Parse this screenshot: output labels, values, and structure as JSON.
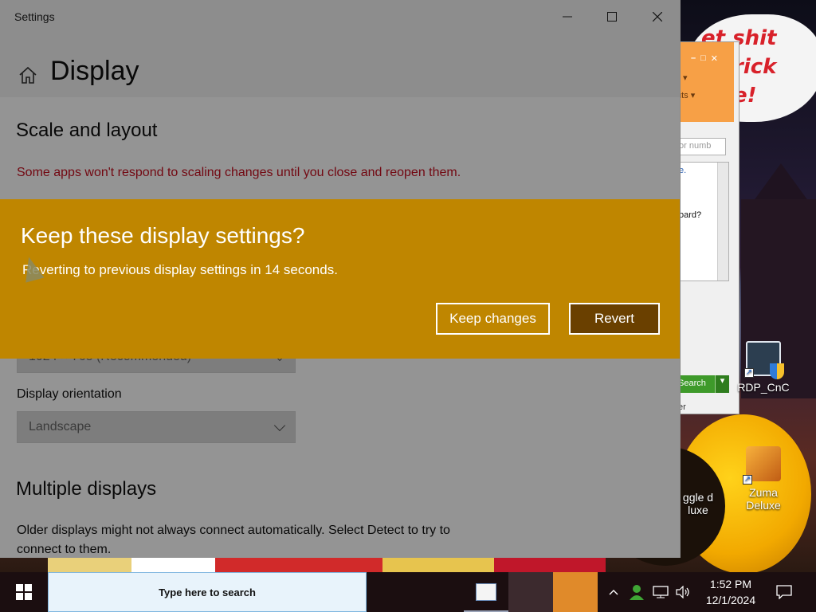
{
  "settings_window": {
    "app_title": "Settings",
    "page_title": "Display",
    "scale_section_title": "Scale and layout",
    "scaling_warning": "Some apps won't respond to scaling changes until you close and reopen them.",
    "resolution_value": "1024 × 768 (Recommended)",
    "orientation_label": "Display orientation",
    "orientation_value": "Landscape",
    "multiple_displays_title": "Multiple displays",
    "multiple_displays_text": "Older displays might not always connect automatically. Select Detect to try to connect to them."
  },
  "dialog": {
    "title": "Keep these display settings?",
    "message": "Reverting to previous display settings in 14 seconds.",
    "keep_button": "Keep changes",
    "revert_button": "Revert"
  },
  "desktop": {
    "speech_lines": [
      "et shit",
      "rick",
      "e!"
    ],
    "icons": [
      {
        "label": "RDP_CnC"
      },
      {
        "label": "Zuma Deluxe"
      },
      {
        "label": "ggle d\nluxe"
      }
    ],
    "bg_window": {
      "lbl1": "▾",
      "lbl2": "uts ▾",
      "field_placeholder": "or numb",
      "text1": "e.",
      "text2": "oard?",
      "search_label": "Search",
      "footer": "er"
    }
  },
  "taskbar": {
    "search_placeholder": "Type here to search",
    "time": "1:52 PM",
    "date": "12/1/2024"
  },
  "colors": {
    "dialog_bg": "#bf8600",
    "revert_bg": "#6a4000",
    "warning_text": "#c50f1f"
  }
}
